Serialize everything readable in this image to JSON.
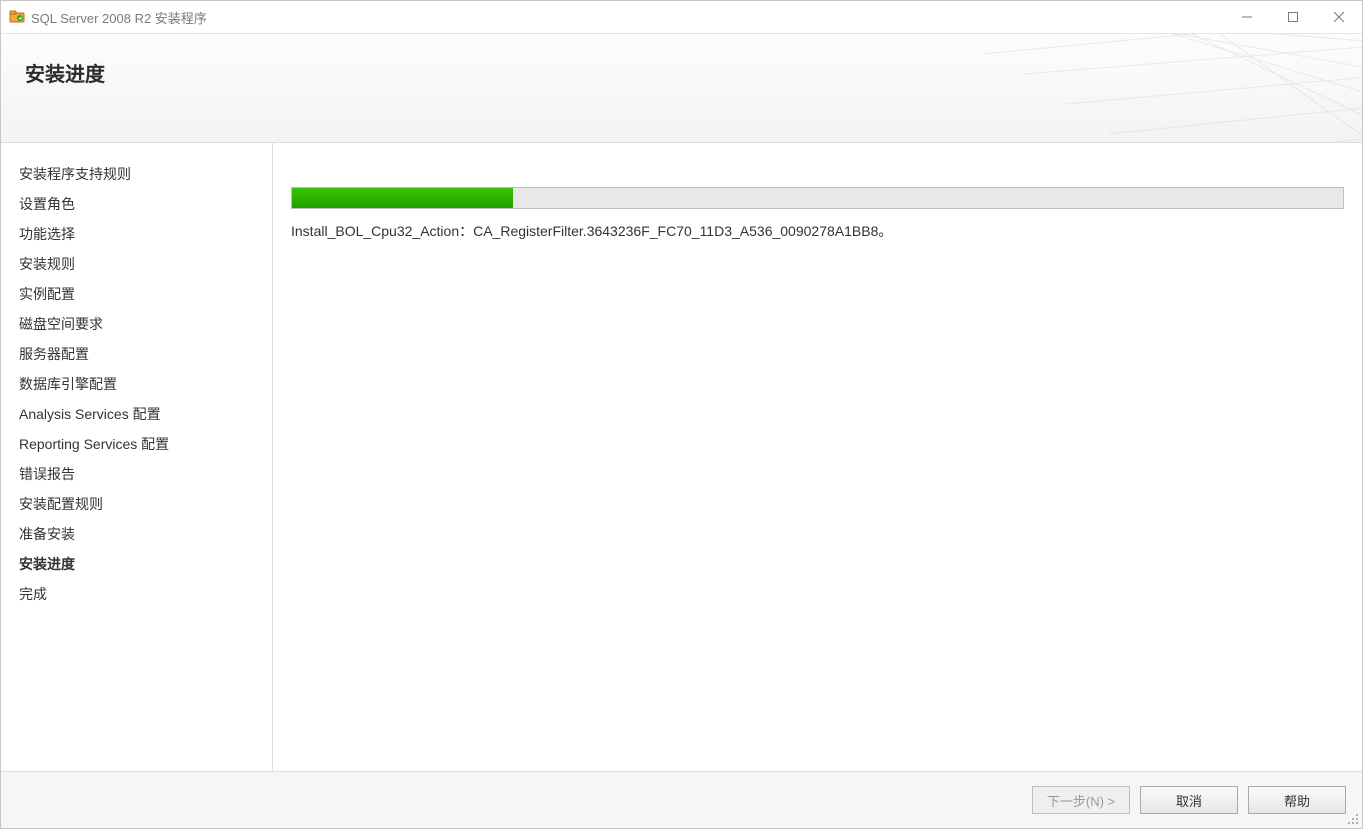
{
  "window": {
    "title": "SQL Server 2008 R2 安装程序"
  },
  "header": {
    "title": "安装进度"
  },
  "sidebar": {
    "items": [
      {
        "label": "安装程序支持规则",
        "active": false
      },
      {
        "label": "设置角色",
        "active": false
      },
      {
        "label": "功能选择",
        "active": false
      },
      {
        "label": "安装规则",
        "active": false
      },
      {
        "label": "实例配置",
        "active": false
      },
      {
        "label": "磁盘空间要求",
        "active": false
      },
      {
        "label": "服务器配置",
        "active": false
      },
      {
        "label": "数据库引擎配置",
        "active": false
      },
      {
        "label": "Analysis Services 配置",
        "active": false
      },
      {
        "label": "Reporting Services 配置",
        "active": false
      },
      {
        "label": "错误报告",
        "active": false
      },
      {
        "label": "安装配置规则",
        "active": false
      },
      {
        "label": "准备安装",
        "active": false
      },
      {
        "label": "安装进度",
        "active": true
      },
      {
        "label": "完成",
        "active": false
      }
    ]
  },
  "progress": {
    "percent": 21,
    "status": "Install_BOL_Cpu32_Action：CA_RegisterFilter.3643236F_FC70_11D3_A536_0090278A1BB8。"
  },
  "buttons": {
    "next": "下一步(N) >",
    "cancel": "取消",
    "help": "帮助"
  }
}
